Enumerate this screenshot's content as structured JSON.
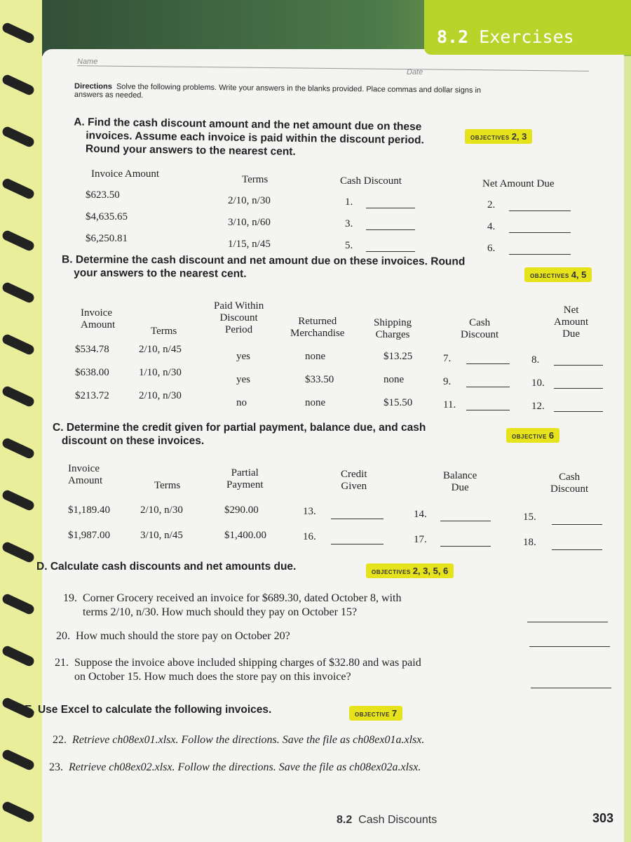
{
  "header": {
    "title_num": "8.2",
    "title": "Exercises",
    "name_label": "Name",
    "date_label": "Date"
  },
  "directions": {
    "label": "Directions",
    "text": "Solve the following problems. Write your answers in the blanks provided. Place commas and dollar signs in",
    "text2": "answers as needed."
  },
  "A": {
    "letter": "A.",
    "l1": "Find the cash discount amount and the net amount due on these",
    "l2": "invoices. Assume each invoice is paid within the discount period.",
    "l3": "Round your answers to the nearest cent.",
    "obj_label": "OBJECTIVES",
    "obj": "2, 3",
    "headers": [
      "Invoice Amount",
      "Terms",
      "Cash Discount",
      "Net Amount Due"
    ],
    "rows": [
      [
        "$623.50",
        "2/10, n/30",
        "1.",
        "2."
      ],
      [
        "$4,635.65",
        "3/10, n/60",
        "3.",
        "4."
      ],
      [
        "$6,250.81",
        "1/15, n/45",
        "5.",
        "6."
      ]
    ]
  },
  "B": {
    "letter": "B.",
    "l1": "Determine the cash discount and net amount due on these invoices. Round",
    "l2": "your answers to the nearest cent.",
    "obj_label": "OBJECTIVES",
    "obj": "4, 5",
    "headers": [
      "Invoice\nAmount",
      "Terms",
      "Paid Within\nDiscount\nPeriod",
      "Returned\nMerchandise",
      "Shipping\nCharges",
      "Cash\nDiscount",
      "Net\nAmount\nDue"
    ],
    "rows": [
      [
        "$534.78",
        "2/10, n/45",
        "yes",
        "none",
        "$13.25",
        "7.",
        "8."
      ],
      [
        "$638.00",
        "1/10, n/30",
        "yes",
        "$33.50",
        "none",
        "9.",
        "10."
      ],
      [
        "$213.72",
        "2/10, n/30",
        "no",
        "none",
        "$15.50",
        "11.",
        "12."
      ]
    ]
  },
  "C": {
    "letter": "C.",
    "l1": "Determine the credit given for partial payment, balance due, and cash",
    "l2": "discount on these invoices.",
    "obj_label": "OBJECTIVE",
    "obj": "6",
    "headers": [
      "Invoice\nAmount",
      "Terms",
      "Partial\nPayment",
      "Credit\nGiven",
      "Balance\nDue",
      "Cash\nDiscount"
    ],
    "rows": [
      [
        "$1,189.40",
        "2/10, n/30",
        "$290.00",
        "13.",
        "14.",
        "15."
      ],
      [
        "$1,987.00",
        "3/10, n/45",
        "$1,400.00",
        "16.",
        "17.",
        "18."
      ]
    ]
  },
  "D": {
    "letter": "D.",
    "title": "Calculate cash discounts and net amounts due.",
    "obj_label": "OBJECTIVES",
    "obj": "2, 3, 5, 6",
    "q19": {
      "num": "19.",
      "l1": "Corner Grocery received an invoice for $689.30, dated October 8, with",
      "l2": "terms 2/10, n/30. How much should they pay on October 15?"
    },
    "q20": {
      "num": "20.",
      "l1": "How much should the store pay on October 20?"
    },
    "q21": {
      "num": "21.",
      "l1": "Suppose the invoice above included shipping charges of $32.80 and was paid",
      "l2": "on October 15. How much does the store pay on this invoice?"
    }
  },
  "E": {
    "letter": "E.",
    "title": "Use Excel to calculate the following invoices.",
    "obj_label": "OBJECTIVE",
    "obj": "7",
    "q22": {
      "num": "22.",
      "text": "Retrieve ch08ex01.xlsx. Follow the directions. Save the file as ch08ex01a.xlsx."
    },
    "q23": {
      "num": "23.",
      "text": "Retrieve ch08ex02.xlsx. Follow the directions. Save the file as ch08ex02a.xlsx."
    }
  },
  "footer": {
    "section": "8.2",
    "title": "Cash Discounts",
    "page": "303"
  }
}
